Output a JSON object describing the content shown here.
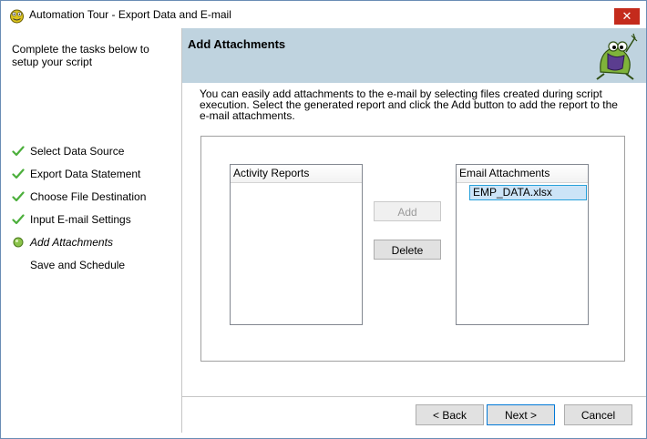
{
  "window": {
    "title": "Automation Tour - Export Data and E-mail",
    "close_label": "✕"
  },
  "sidebar": {
    "intro": "Complete the tasks below to setup your script",
    "steps": [
      {
        "label": "Select Data Source",
        "status": "done"
      },
      {
        "label": "Export Data Statement",
        "status": "done"
      },
      {
        "label": "Choose File Destination",
        "status": "done"
      },
      {
        "label": "Input E-mail Settings",
        "status": "done"
      },
      {
        "label": "Add Attachments",
        "status": "current"
      },
      {
        "label": "Save and Schedule",
        "status": "pending"
      }
    ]
  },
  "header": {
    "title": "Add Attachments"
  },
  "description": "You can easily add attachments to the e-mail by selecting files created during script execution. Select the generated report and click the Add button to add the report to the e-mail attachments.",
  "activity_reports": {
    "header": "Activity Reports",
    "items": []
  },
  "email_attachments": {
    "header": "Email Attachments",
    "items": [
      {
        "label": "EMP_DATA.xlsx",
        "selected": true
      }
    ]
  },
  "actions": {
    "add_label": "Add",
    "add_enabled": false,
    "delete_label": "Delete"
  },
  "footer": {
    "back_label": "< Back",
    "next_label": "Next >",
    "cancel_label": "Cancel"
  },
  "colors": {
    "header_bg": "#bfd3df",
    "check_green": "#4caf3c",
    "current_dot": "#8bc34a",
    "close_red": "#c42b1c",
    "selection_bg": "#cce4f7",
    "selection_border": "#26a0da"
  },
  "icons": {
    "app": "frog-app-icon",
    "done": "checkmark-icon",
    "current": "green-dot-icon",
    "mascot": "frog-mascot-icon"
  }
}
